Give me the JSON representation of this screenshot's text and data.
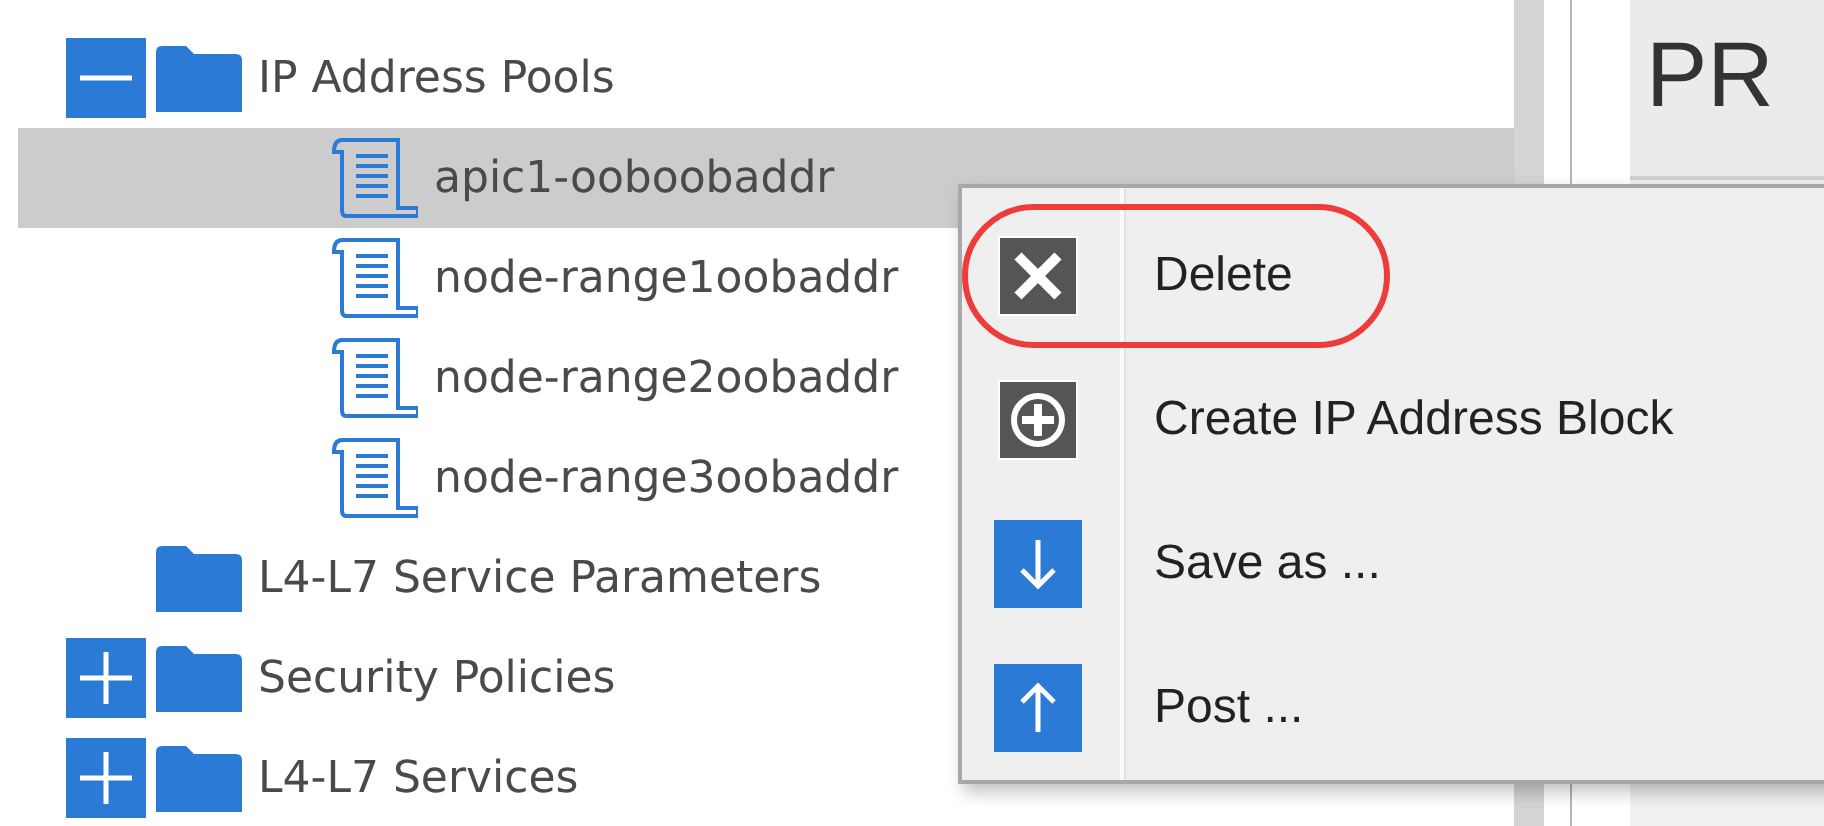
{
  "tree": [
    {
      "kind": "folder",
      "label": "IP Address Pools",
      "expanded": true,
      "selected": false,
      "children": [
        {
          "kind": "document",
          "label": "apic1-ooboobaddr",
          "selected": true
        },
        {
          "kind": "document",
          "label": "node-range1oobaddr",
          "selected": false
        },
        {
          "kind": "document",
          "label": "node-range2oobaddr",
          "selected": false
        },
        {
          "kind": "document",
          "label": "node-range3oobaddr",
          "selected": false
        }
      ]
    },
    {
      "kind": "folder",
      "label": "L4-L7 Service Parameters",
      "selected": false
    },
    {
      "kind": "folder",
      "label": "Security Policies",
      "expanded": false,
      "selected": false
    },
    {
      "kind": "folder",
      "label": "L4-L7 Services",
      "expanded": false,
      "selected": false
    }
  ],
  "detail": {
    "heading": "PR"
  },
  "context_menu": [
    {
      "kind": "delete",
      "label": "Delete",
      "circled": true
    },
    {
      "kind": "create",
      "label": "Create IP Address Block",
      "circled": false
    },
    {
      "kind": "save",
      "label": "Save as ...",
      "circled": false
    },
    {
      "kind": "post",
      "label": "Post ...",
      "circled": false
    }
  ]
}
